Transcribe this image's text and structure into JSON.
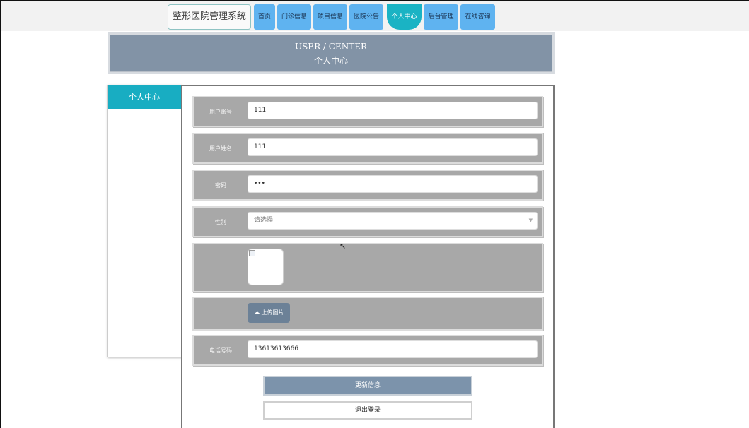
{
  "nav": {
    "brand": "整形医院管理系统",
    "items": [
      {
        "label": "首页"
      },
      {
        "label": "门诊信息"
      },
      {
        "label": "项目信息"
      },
      {
        "label": "医院公告"
      },
      {
        "label": "个人中心",
        "active": true
      },
      {
        "label": "后台管理"
      },
      {
        "label": "在线咨询"
      }
    ]
  },
  "banner": {
    "en": "USER / CENTER",
    "cn": "个人中心"
  },
  "sidebar": {
    "items": [
      {
        "label": "个人中心"
      }
    ]
  },
  "form": {
    "account": {
      "label": "用户账号",
      "value": "111"
    },
    "name": {
      "label": "用户姓名",
      "value": "111"
    },
    "password": {
      "label": "密码",
      "value": "•••"
    },
    "gender": {
      "label": "性别",
      "value": "请选择"
    },
    "upload_label": "上传图片",
    "phone": {
      "label": "电话号码",
      "value": "13613613666"
    }
  },
  "actions": {
    "update": "更新信息",
    "logout": "退出登录"
  },
  "colors": {
    "nav_button": "#5fb3f0",
    "nav_active": "#1ab3c4",
    "banner": "#8293a6",
    "row_bg": "#a8a8a8",
    "update_button": "#7c93ab"
  }
}
